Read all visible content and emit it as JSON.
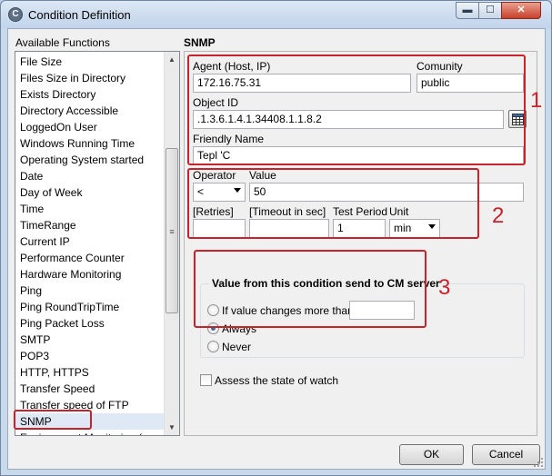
{
  "window": {
    "title": "Condition Definition",
    "app_icon_glyph": "C",
    "buttons": {
      "minimize": "▬",
      "maximize": "☐",
      "close": "✕"
    }
  },
  "functions": {
    "label": "Available Functions",
    "items": [
      "File Size",
      "Files Size in Directory",
      "Exists Directory",
      "Directory Accessible",
      "LoggedOn User",
      "Windows Running Time",
      "Operating System started",
      "Date",
      "Day of Week",
      "Time",
      "TimeRange",
      "Current IP",
      "Performance Counter",
      "Hardware Monitoring",
      "Ping",
      "Ping RoundTripTime",
      "Ping Packet Loss",
      "SMTP",
      "POP3",
      "HTTP, HTTPS",
      "Transfer Speed",
      "Transfer speed of FTP",
      "SNMP",
      "Environment Monitoring (sensor)"
    ],
    "selected": "SNMP"
  },
  "snmp": {
    "title": "SNMP",
    "agent": {
      "label": "Agent (Host, IP)",
      "value": "172.16.75.31"
    },
    "community": {
      "label": "Comunity",
      "value": "public"
    },
    "oid": {
      "label": "Object ID",
      "value": ".1.3.6.1.4.1.34408.1.1.8.2"
    },
    "friendly": {
      "label": "Friendly Name",
      "value": "Tepl 'C"
    },
    "operator": {
      "label": "Operator",
      "value": "<"
    },
    "value": {
      "label": "Value",
      "value": "50"
    },
    "retries": {
      "label": "[Retries]",
      "value": ""
    },
    "timeout": {
      "label": "[Timeout in sec]",
      "value": ""
    },
    "test_period": {
      "label": "Test Period",
      "value": "1"
    },
    "unit": {
      "label": "Unit",
      "value": "min"
    }
  },
  "send": {
    "title": "Value from this condition send to CM server",
    "options": [
      {
        "label": "If value changes more than",
        "checked": false
      },
      {
        "label": "Always",
        "checked": true
      },
      {
        "label": "Never",
        "checked": false
      }
    ],
    "threshold_value": ""
  },
  "assess": {
    "label": "Assess the state of watch",
    "checked": false
  },
  "annotations": {
    "box1": "1",
    "box2": "2",
    "box3": "3",
    "color": "#c8232c"
  },
  "footer": {
    "ok": "OK",
    "cancel": "Cancel"
  },
  "icons": {
    "app": "app-icon",
    "oid_picker": "grid-icon",
    "list_up": "arrow-up-icon",
    "list_down": "arrow-down-icon",
    "dropdown": "chevron-down-icon"
  },
  "scroll": {
    "arrow_up": "▲",
    "arrow_down": "▼",
    "thumb_grip": "≡"
  }
}
